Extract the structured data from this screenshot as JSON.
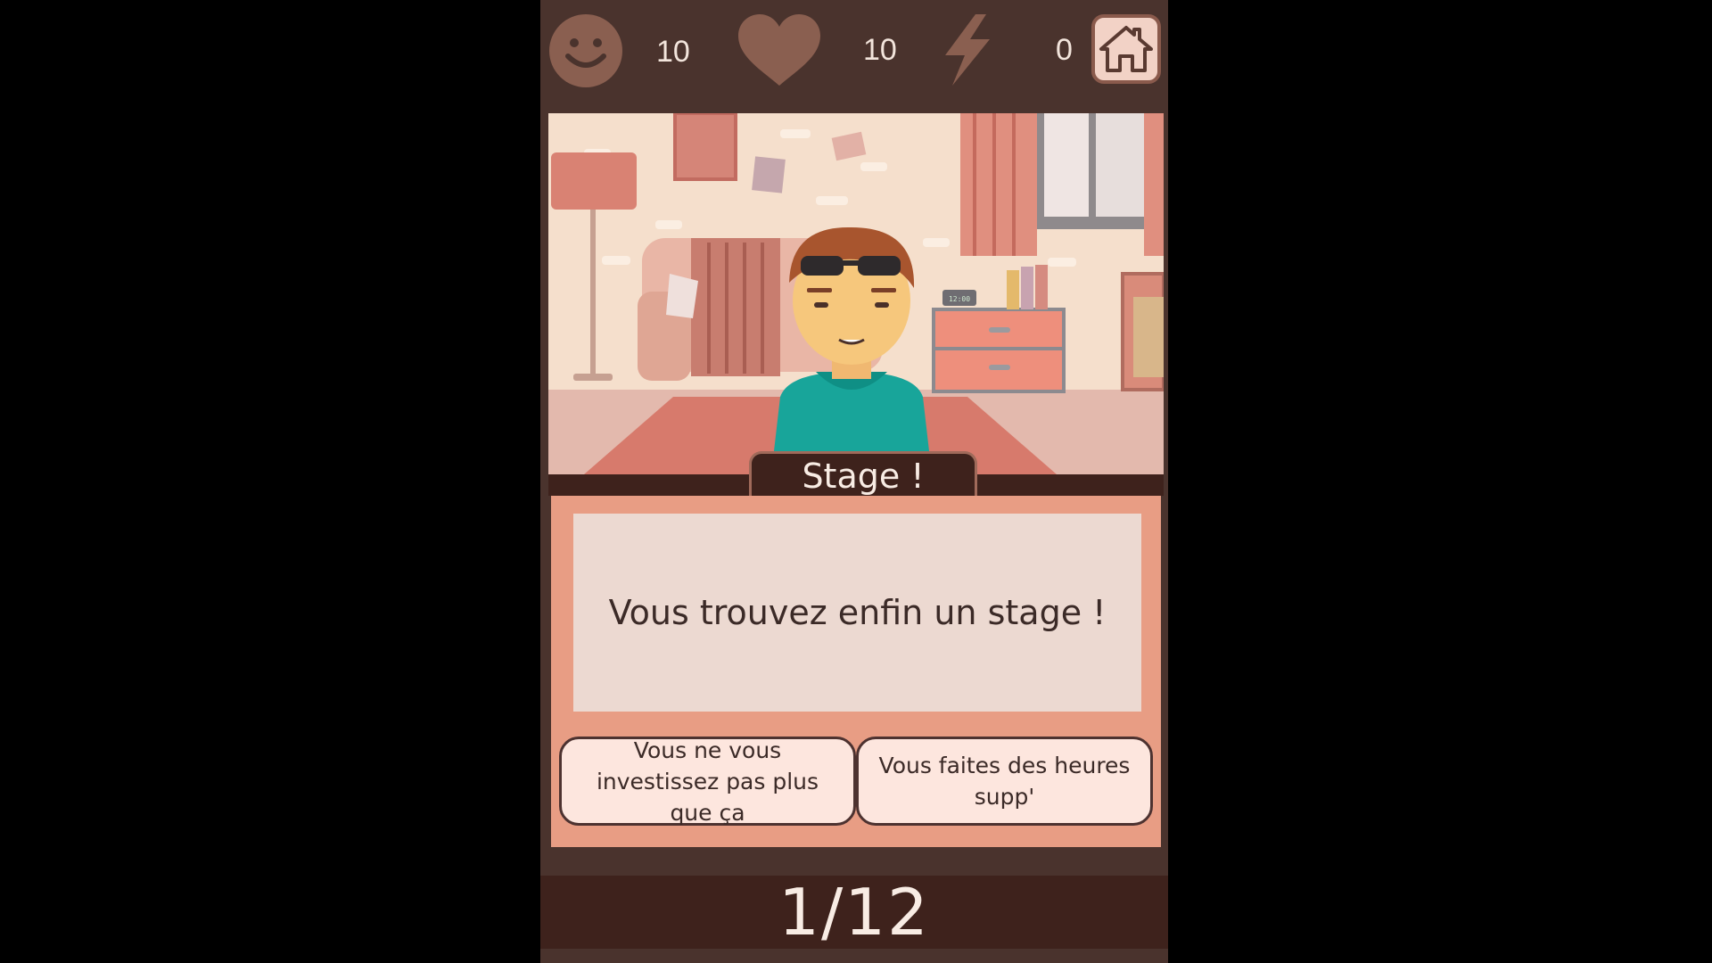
{
  "stats": {
    "happiness": {
      "icon": "smiley-icon",
      "value": "10"
    },
    "love": {
      "icon": "heart-icon",
      "value": "10"
    },
    "energy": {
      "icon": "lightning-icon",
      "value": "0"
    }
  },
  "home_button": {
    "icon": "home-icon"
  },
  "scene": {
    "clock_text": "12:00"
  },
  "event": {
    "title": "Stage !",
    "message": "Vous trouvez enfin un stage !"
  },
  "choices": [
    {
      "label": "Vous ne vous investissez pas plus que ça"
    },
    {
      "label": "Vous faites des heures supp'"
    }
  ],
  "progress": {
    "text": "1/12"
  },
  "colors": {
    "background": "#4a332d",
    "dark_bar": "#3e221c",
    "panel": "#e89d84",
    "message_box": "#ecd9d1",
    "choice_bg": "#fde6de",
    "icon_inactive": "#8a5f50"
  }
}
